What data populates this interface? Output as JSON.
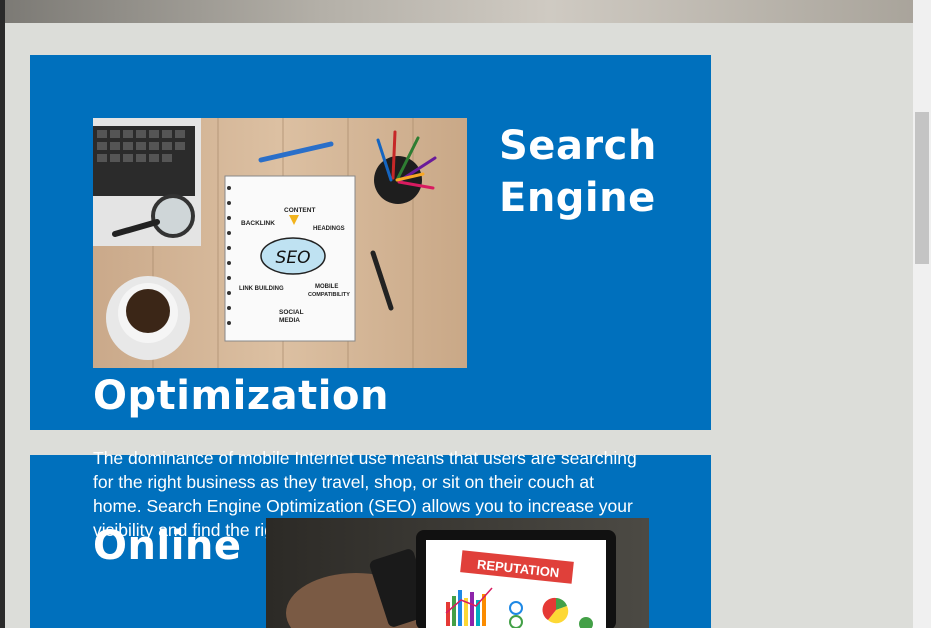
{
  "section1": {
    "heading_line1": "Search",
    "heading_line2": "Engine",
    "heading_line3": "Optimization",
    "paragraph": "The dominance of mobile Internet use means that users are searching for the right business as they travel, shop, or sit on their couch at home. Search Engine Optimization (SEO) allows you to increase your visibility and find the right customers for your business.",
    "image": {
      "notebook_center": "SEO",
      "labels": [
        "CONTENT",
        "BACKLINK",
        "HEADINGS",
        "LINK BUILDING",
        "MOBILE",
        "COMPATIBILITY",
        "SOCIAL",
        "MEDIA"
      ]
    }
  },
  "section2": {
    "heading": "Online",
    "image": {
      "banner": "REPUTATION"
    }
  },
  "colors": {
    "card": "#0070bd",
    "page_bg": "#dcddd9",
    "text": "#ffffff"
  }
}
